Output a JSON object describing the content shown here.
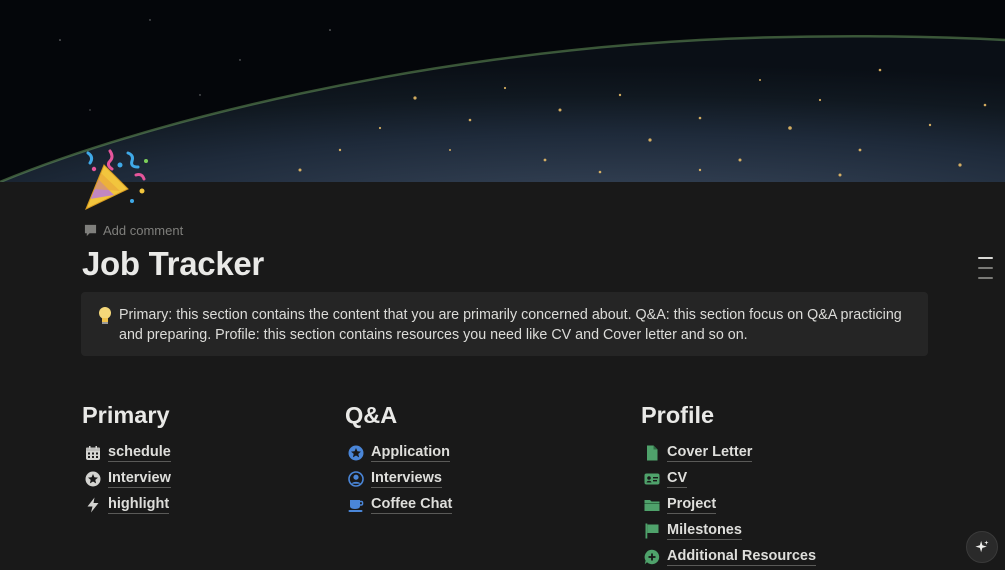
{
  "page": {
    "title": "Job Tracker",
    "add_comment_label": "Add comment",
    "page_icon": "party-popper-icon",
    "cover": "earth-from-space-at-night"
  },
  "callout": {
    "icon": "light-bulb-icon",
    "text": "Primary: this section contains the content that you are primarily concerned about. Q&A: this section focus on Q&A practicing and preparing. Profile: this section contains resources you need like CV and Cover letter and so on."
  },
  "columns": [
    {
      "heading": "Primary",
      "links": [
        {
          "label": "schedule",
          "icon": "calendar-icon"
        },
        {
          "label": "Interview",
          "icon": "star-circle-icon"
        },
        {
          "label": "highlight",
          "icon": "lightning-icon"
        }
      ]
    },
    {
      "heading": "Q&A",
      "links": [
        {
          "label": "Application",
          "icon": "blue-star-circle-icon"
        },
        {
          "label": "Interviews",
          "icon": "user-circle-icon"
        },
        {
          "label": "Coffee Chat",
          "icon": "coffee-cup-icon"
        }
      ]
    },
    {
      "heading": "Profile",
      "links": [
        {
          "label": "Cover Letter",
          "icon": "document-icon"
        },
        {
          "label": "CV",
          "icon": "id-card-icon"
        },
        {
          "label": "Project",
          "icon": "folder-icon"
        },
        {
          "label": "Milestones",
          "icon": "flag-icon"
        },
        {
          "label": "Additional Resources",
          "icon": "plus-chat-icon"
        }
      ]
    }
  ],
  "colors": {
    "background": "#191919",
    "callout_bg": "#252525",
    "blue_icon": "#4a86d8",
    "green_icon": "#4fa26b"
  }
}
